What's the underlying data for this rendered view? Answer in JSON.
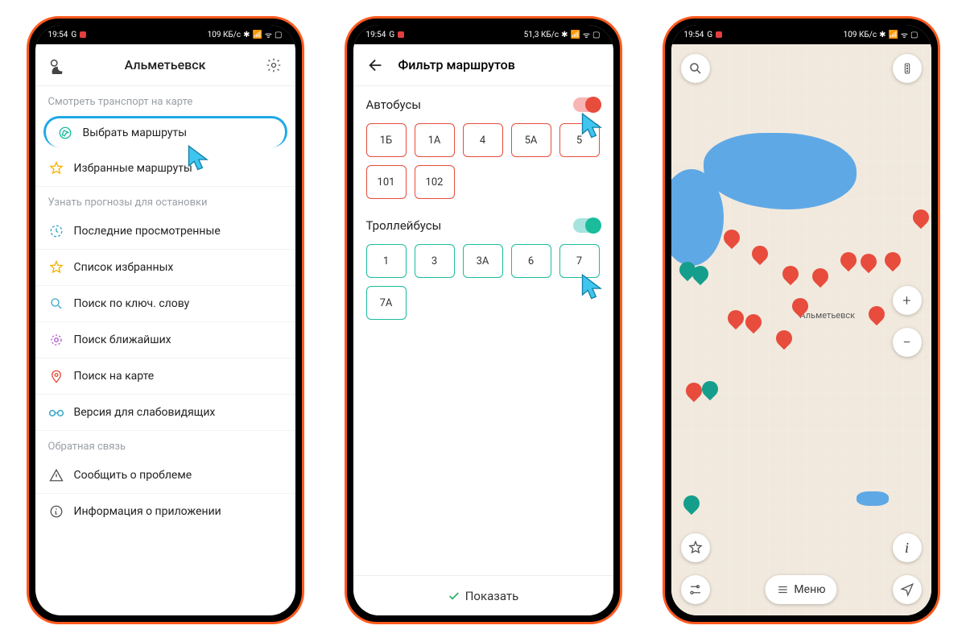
{
  "status": {
    "time": "19:54",
    "net_g": "G",
    "rate1": "109 КБ/с",
    "rate2": "51,3 КБ/с"
  },
  "screen1": {
    "title": "Альметьевск",
    "section_map": "Смотреть транспорт на карте",
    "item_select_routes": "Выбрать маршруты",
    "item_favorite_routes": "Избранные маршруты",
    "section_forecast": "Узнать прогнозы для остановки",
    "item_recent": "Последние просмотренные",
    "item_fav_list": "Список избранных",
    "item_search_keyword": "Поиск по ключ. слову",
    "item_search_nearby": "Поиск ближайших",
    "item_search_map": "Поиск на карте",
    "item_low_vision": "Версия для слабовидящих",
    "section_feedback": "Обратная связь",
    "item_report": "Сообщить о проблеме",
    "item_about": "Информация о приложении"
  },
  "screen2": {
    "title": "Фильтр маршрутов",
    "group_bus": "Автобусы",
    "group_trolley": "Троллейбусы",
    "bus_routes": [
      "1Б",
      "1А",
      "4",
      "5А",
      "5",
      "101",
      "102"
    ],
    "trolley_routes": [
      "1",
      "3",
      "3А",
      "6",
      "7",
      "7А"
    ],
    "show": "Показать"
  },
  "screen3": {
    "city": "Альметьевск",
    "menu": "Меню"
  }
}
